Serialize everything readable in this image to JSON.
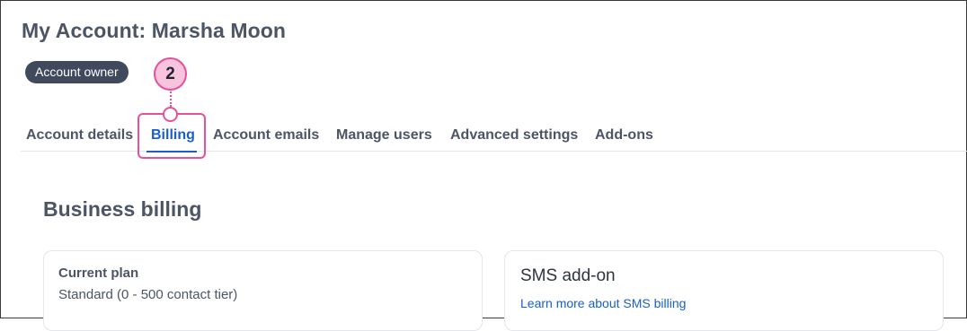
{
  "page": {
    "title": "My Account: Marsha Moon",
    "badge": "Account owner"
  },
  "tabs": [
    {
      "label": "Account details",
      "active": false
    },
    {
      "label": "Billing",
      "active": true
    },
    {
      "label": "Account emails",
      "active": false
    },
    {
      "label": "Manage users",
      "active": false
    },
    {
      "label": "Advanced settings",
      "active": false
    },
    {
      "label": "Add-ons",
      "active": false
    }
  ],
  "callout": {
    "number": "2",
    "color": "#e8509a",
    "fill": "#f7c3dd"
  },
  "billing": {
    "title": "Business billing",
    "current_plan": {
      "label": "Current plan",
      "value": "Standard (0 - 500 contact tier)"
    },
    "sms_addon": {
      "title": "SMS add-on",
      "link": "Learn more about SMS billing"
    }
  },
  "colors": {
    "accent": "#1a5fc8",
    "text": "#4b5565",
    "badge": "#404a5c"
  }
}
